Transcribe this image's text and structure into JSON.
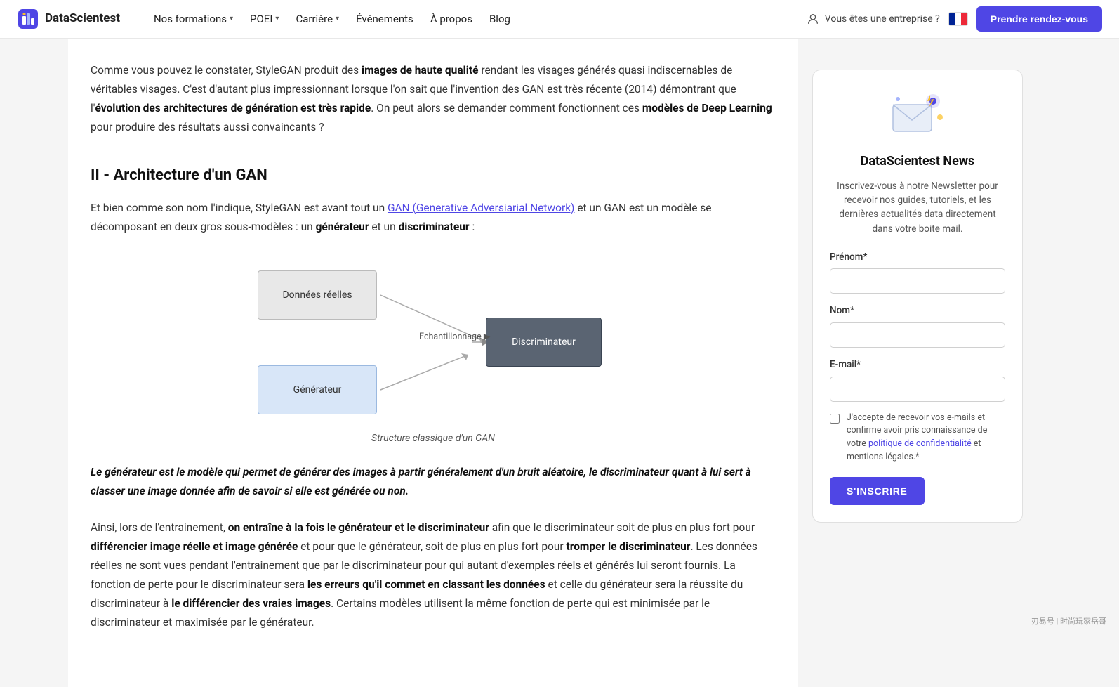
{
  "nav": {
    "logo_text": "DataScientest",
    "items": [
      {
        "label": "Nos formations",
        "has_chevron": true
      },
      {
        "label": "POEI",
        "has_chevron": true
      },
      {
        "label": "Carrière",
        "has_chevron": true
      },
      {
        "label": "Événements",
        "has_chevron": false
      },
      {
        "label": "À propos",
        "has_chevron": false
      },
      {
        "label": "Blog",
        "has_chevron": false
      }
    ],
    "enterprise_label": "Vous êtes une entreprise ?",
    "cta_label": "Prendre rendez-vous"
  },
  "article": {
    "intro_paragraph": "Comme vous pouvez le constater, StyleGAN produit des ",
    "intro_bold1": "images de haute qualité",
    "intro_rest": " rendant les visages générés quasi indiscernables de véritables visages. C'est d'autant plus impressionnant lorsque l'on sait que l'invention des GAN est très récente (2014) démontrant que l'",
    "intro_bold2": "évolution des architectures de génération est très rapide",
    "intro_rest2": ". On peut alors se demander comment fonctionnent ces ",
    "intro_bold3": "modèles de Deep Learning",
    "intro_end": " pour produire des résultats aussi convaincants ?",
    "section_title": "II - Architecture d'un GAN",
    "section_intro": "Et bien comme son nom l'indique, StyleGAN est avant tout un ",
    "section_link": "GAN (Generative Adversiarial Network)",
    "section_link_rest": " et un GAN est un modèle se décomposant en deux gros sous-modèles : un ",
    "section_bold1": "générateur",
    "section_mid": " et un ",
    "section_bold2": "discriminateur",
    "section_end": " :",
    "diagram": {
      "box_data_label": "Données réelles",
      "box_gen_label": "Générateur",
      "box_disc_label": "Discriminateur",
      "echo_label": "Echantillonnage",
      "caption": "Structure classique d'un GAN"
    },
    "blockquote": "Le générateur est le modèle qui permet de générer des images à partir généralement d'un bruit aléatoire, le discriminateur quant à lui sert à classer une image donnée afin de savoir si elle est générée ou non.",
    "paragraph2_start": "Ainsi, lors de l'entrainement, ",
    "paragraph2_bold": "on entraîne à la fois le générateur et le discriminateur",
    "paragraph2_rest": " afin que le discriminateur soit de plus en plus fort pour ",
    "paragraph2_bold2": "différencier image réelle et image générée",
    "paragraph2_rest2": " et pour que le générateur, soit de plus en plus fort pour ",
    "paragraph2_bold3": "tromper le discriminateur",
    "paragraph2_rest3": ". Les données réelles ne sont vues pendant l'entrainement que par le discriminateur pour qui autant d'exemples réels et générés lui seront fournis. La fonction de perte pour le discriminateur sera ",
    "paragraph2_bold4": "les erreurs qu'il commet en classant les données",
    "paragraph2_rest4": " et celle du générateur sera la réussite du discriminateur à ",
    "paragraph2_bold5": "le différencier des vraies images",
    "paragraph2_end": ". Certains modèles utilisent la même fonction de perte qui est minimisée par le discriminateur et maximisée par le générateur."
  },
  "sidebar": {
    "newsletter_title": "DataScientest News",
    "newsletter_desc": "Inscrivez-vous à notre Newsletter pour recevoir nos guides, tutoriels, et les dernières actualités data directement dans votre boite mail.",
    "form": {
      "prenom_label": "Prénom*",
      "prenom_placeholder": "",
      "nom_label": "Nom*",
      "nom_placeholder": "",
      "email_label": "E-mail*",
      "email_placeholder": "",
      "checkbox_text": "J'accepte de recevoir vos e-mails et confirme avoir pris connaissance de votre politique de confidentialité et mentions légales.*",
      "submit_label": "S'INSCRIRE"
    }
  },
  "watermark": "刃易号 | 时尚玩家岳哥"
}
